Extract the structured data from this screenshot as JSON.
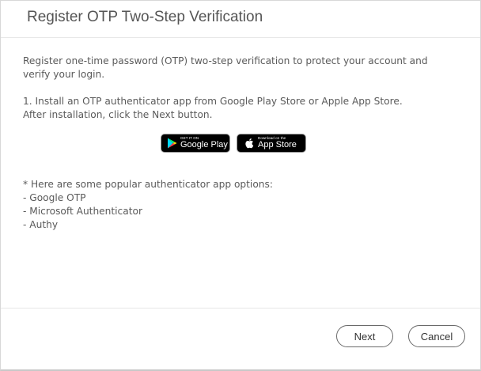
{
  "dialog": {
    "title": "Register OTP Two-Step Verification"
  },
  "content": {
    "intro": "Register one-time password (OTP) two-step verification to protect your account and verify your login.",
    "step_line1": "1. Install an OTP authenticator app from Google Play Store or Apple App Store.",
    "step_line2": "After installation, click the Next button."
  },
  "stores": {
    "google_play": {
      "small": "GET IT ON",
      "big": "Google Play",
      "icon": "google-play-icon"
    },
    "app_store": {
      "small": "Download on the",
      "big": "App Store",
      "icon": "apple-icon"
    }
  },
  "tips": {
    "heading": "* Here are some popular authenticator app options:",
    "items": [
      "- Google OTP",
      "- Microsoft Authenticator",
      "- Authy"
    ]
  },
  "footer": {
    "next_label": "Next",
    "cancel_label": "Cancel"
  }
}
